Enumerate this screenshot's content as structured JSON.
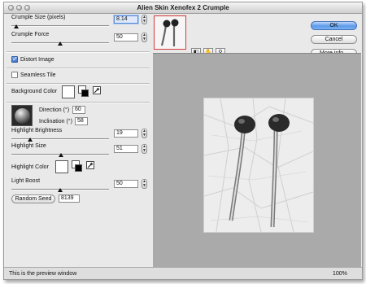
{
  "window": {
    "title": "Alien Skin Xenofex 2 Crumple"
  },
  "controls": {
    "crumple_size": {
      "label": "Crumple Size (pixels)",
      "value": "8.14",
      "slider": 0.05
    },
    "crumple_force": {
      "label": "Crumple Force",
      "value": "50",
      "slider": 0.5
    },
    "distort_image": {
      "label": "Distort Image",
      "checked": true
    },
    "seamless_tile": {
      "label": "Seamless Tile",
      "checked": false
    },
    "background_color": {
      "label": "Background Color",
      "color": "#ffffff",
      "secondary": "#000000"
    },
    "direction": {
      "label": "Direction (°)",
      "value": "60"
    },
    "inclination": {
      "label": "Inclination (°)",
      "value": "58"
    },
    "highlight_brightness": {
      "label": "Highlight Brightness",
      "value": "19",
      "slider": 0.19
    },
    "highlight_size": {
      "label": "Highlight Size",
      "value": "51",
      "slider": 0.51
    },
    "highlight_color": {
      "label": "Highlight Color",
      "color": "#ffffff",
      "secondary": "#000000"
    },
    "light_boost": {
      "label": "Light Boost",
      "value": "50",
      "slider": 0.5
    },
    "random_seed": {
      "label": "Random Seed",
      "value": "8139"
    }
  },
  "buttons": {
    "ok": "OK",
    "cancel": "Cancel",
    "more_info": "More info..."
  },
  "tools": [
    "compare-icon",
    "hand-icon",
    "zoom-icon"
  ],
  "status": {
    "message": "This is the preview window",
    "zoom": "100%"
  },
  "colors": {
    "ok_button": "#5c9ae8",
    "focus": "#5a8bd6",
    "preview_bg": "#aaaaaa"
  }
}
